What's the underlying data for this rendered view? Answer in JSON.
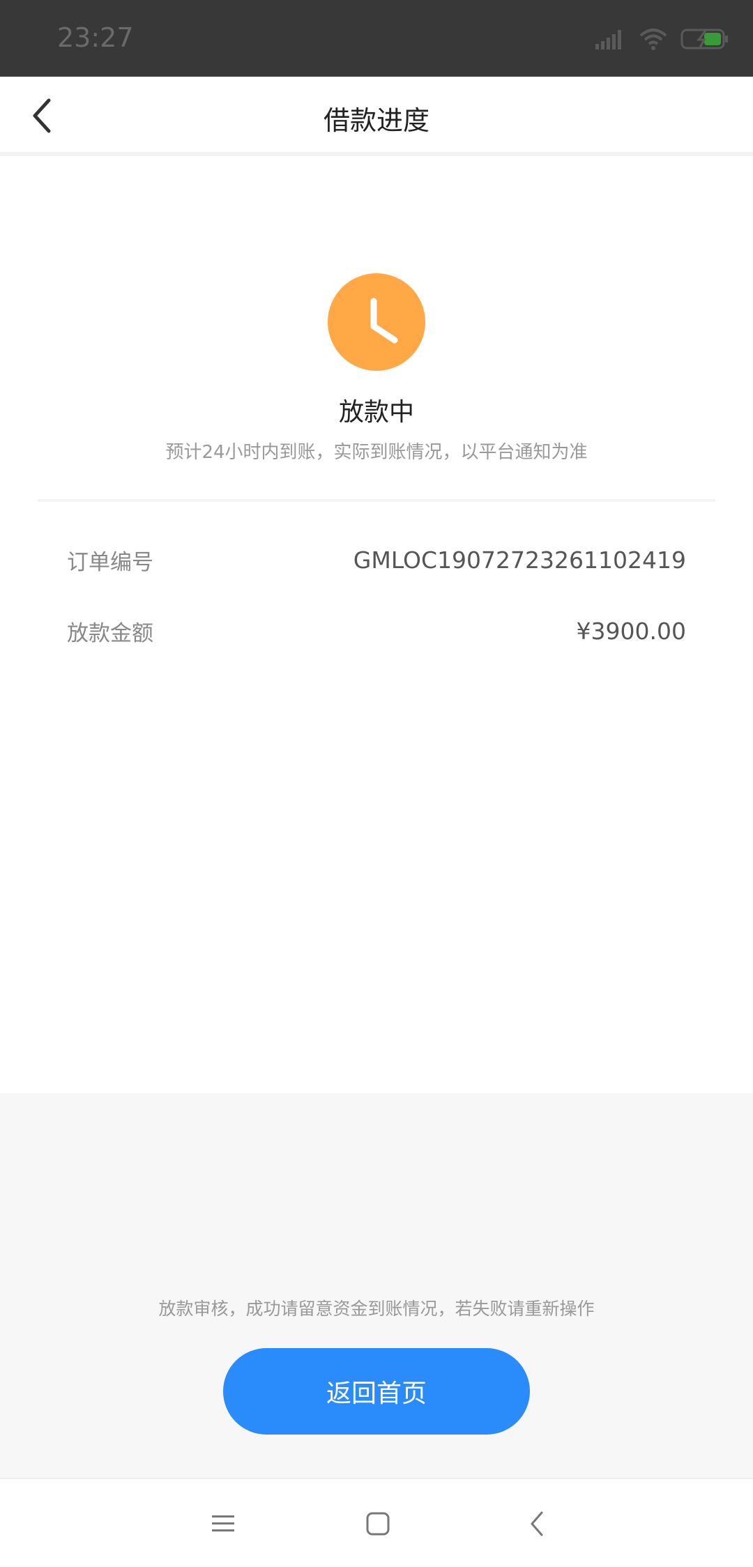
{
  "status_bar": {
    "time": "23:27",
    "icons": [
      "signal-icon",
      "wifi-icon",
      "battery-charging-icon"
    ]
  },
  "header": {
    "title": "借款进度",
    "back_icon": "chevron-left-icon"
  },
  "status": {
    "icon": "clock-icon",
    "icon_color": "#FFA845",
    "title": "放款中",
    "subtitle": "预计24小时内到账，实际到账情况，以平台通知为准"
  },
  "details": [
    {
      "label": "订单编号",
      "value": "GMLOC19072723261102419"
    },
    {
      "label": "放款金额",
      "value": "¥3900.00"
    }
  ],
  "footer": {
    "notice": "放款审核，成功请留意资金到账情况，若失败请重新操作",
    "button_label": "返回首页",
    "button_color": "#2A8BFB"
  },
  "nav_bar": {
    "icons": [
      "menu-icon",
      "home-square-icon",
      "back-icon"
    ]
  }
}
